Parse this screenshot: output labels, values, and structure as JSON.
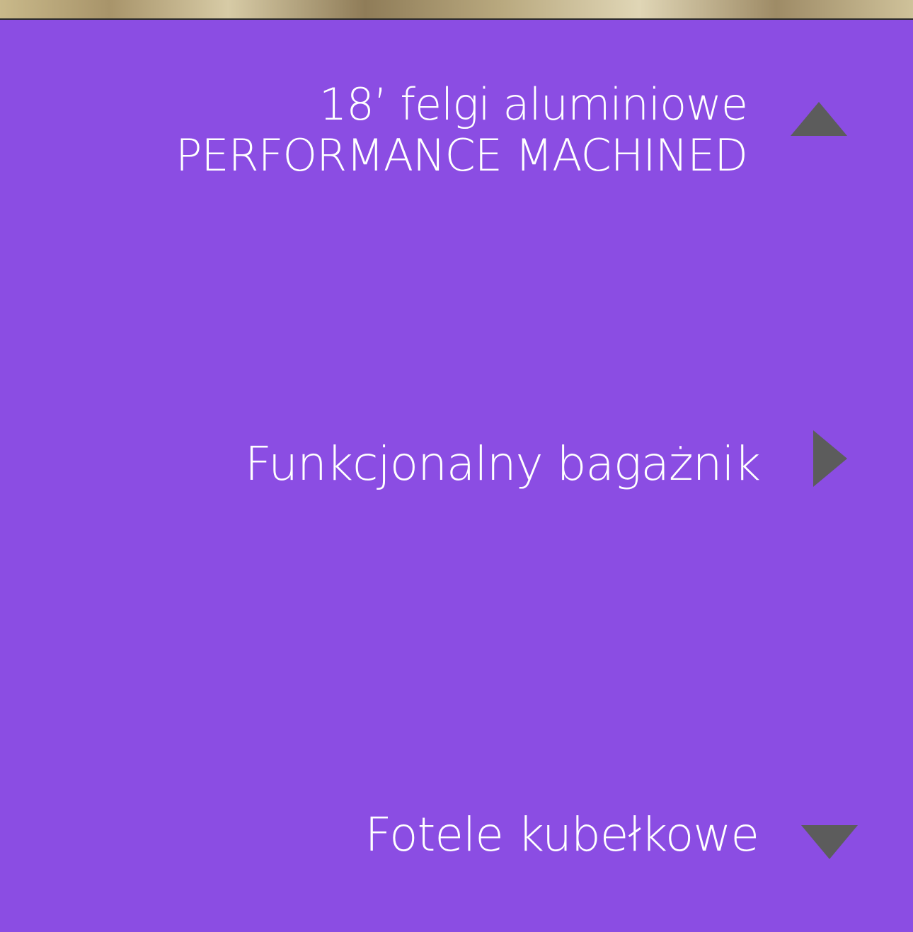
{
  "colors": {
    "panel_background": "#8b4de3",
    "text": "#ffffff",
    "arrow": "#5c5c5c"
  },
  "features": [
    {
      "line1": "18’ felgi aluminiowe",
      "line2": "PERFORMANCE MACHINED",
      "icon": "triangle-up-icon"
    },
    {
      "label": "Funkcjonalny bagażnik",
      "icon": "triangle-right-icon"
    },
    {
      "label": "Fotele kubełkowe",
      "icon": "triangle-down-icon"
    }
  ]
}
